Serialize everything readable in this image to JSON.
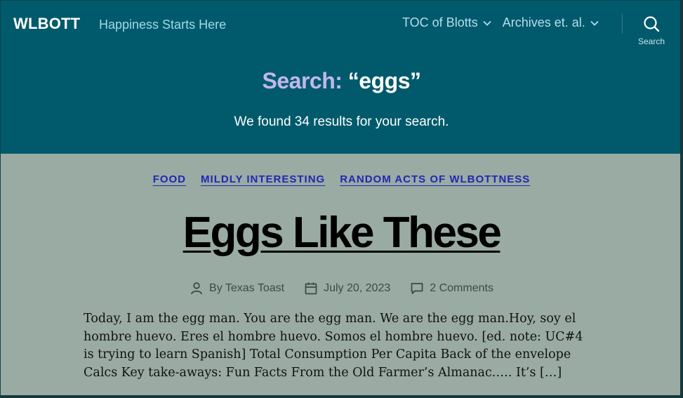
{
  "header": {
    "site_title": "WLBOTT",
    "tagline": "Happiness Starts Here",
    "nav": [
      {
        "label": "TOC of Blotts"
      },
      {
        "label": "Archives et. al."
      }
    ],
    "search_label": "Search",
    "search_heading_prefix": "Search:",
    "search_query": "“eggs”",
    "results_text": "We found 34 results for your search."
  },
  "post": {
    "categories": [
      "FOOD",
      "MILDLY INTERESTING",
      "RANDOM ACTS OF WLBOTTNESS"
    ],
    "title": "Eggs Like These",
    "author": "By Texas Toast",
    "date": "July 20, 2023",
    "comments": "2 Comments",
    "excerpt": "Today, I am the egg man. You are the egg man. We are the egg man.Hoy, soy el hombre huevo. Eres el hombre huevo. Somos el hombre huevo. [ed. note: UC#4 is trying to learn Spanish] Total Consumption Per Capita Back of the envelope Calcs Key take-aways: Fun Facts From the Old Farmer’s Almanac.…. It’s […]"
  },
  "colors": {
    "header_bg": "#005a6b",
    "content_bg": "#99aba3",
    "category_link": "#1f28b3",
    "search_prefix": "#c3b7ea"
  },
  "icons": {
    "nav_chevron": "chevron-down-icon",
    "search": "search-icon",
    "author": "user-icon",
    "date": "calendar-icon",
    "comments": "comment-icon"
  }
}
